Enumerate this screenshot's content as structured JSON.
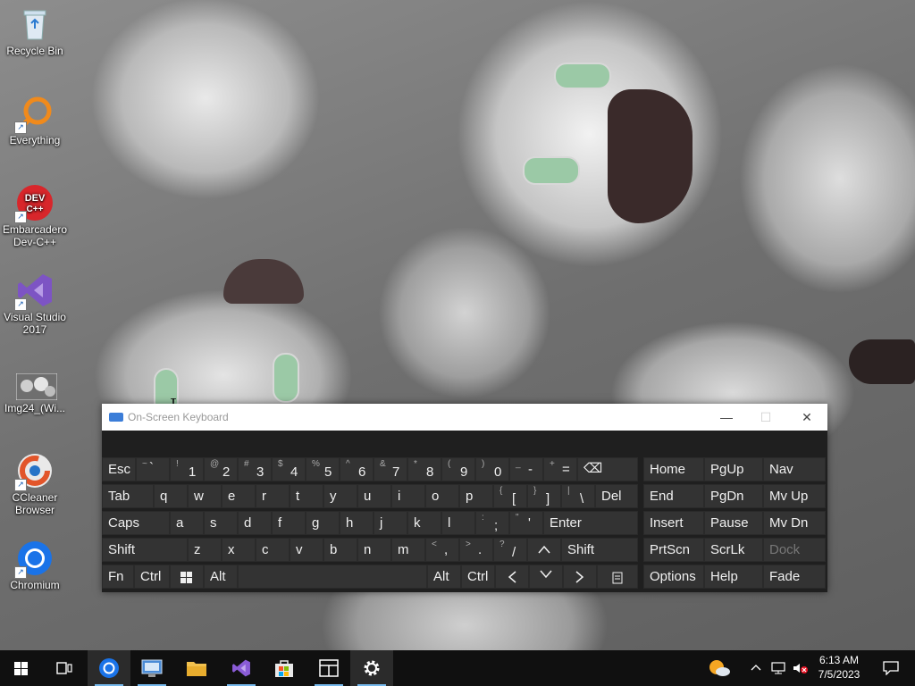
{
  "desktop": {
    "icons": [
      {
        "label": "Recycle Bin"
      },
      {
        "label": "Everything"
      },
      {
        "label": "Embarcadero Dev-C++"
      },
      {
        "label": "Visual Studio 2017"
      },
      {
        "label": "Img24_(Wi..."
      },
      {
        "label": "CCleaner Browser"
      },
      {
        "label": "Chromium"
      }
    ]
  },
  "osk": {
    "title": "On-Screen Keyboard",
    "keys": {
      "esc": "Esc",
      "tilde_shift": "~",
      "tilde": "`",
      "n1s": "!",
      "n1": "1",
      "n2s": "@",
      "n2": "2",
      "n3s": "#",
      "n3": "3",
      "n4s": "$",
      "n4": "4",
      "n5s": "%",
      "n5": "5",
      "n6s": "^",
      "n6": "6",
      "n7s": "&",
      "n7": "7",
      "n8s": "*",
      "n8": "8",
      "n9s": "(",
      "n9": "9",
      "n0s": ")",
      "n0": "0",
      "minus_s": "_",
      "minus": "-",
      "eq_s": "+",
      "eq": "=",
      "backspace": "⌫",
      "tab": "Tab",
      "q": "q",
      "w": "w",
      "e": "e",
      "r": "r",
      "t": "t",
      "y": "y",
      "u": "u",
      "i": "i",
      "o": "o",
      "p": "p",
      "lb_s": "{",
      "lb": "[",
      "rb_s": "}",
      "rb": "]",
      "bs_s": "|",
      "bs": "\\",
      "del": "Del",
      "caps": "Caps",
      "a": "a",
      "s": "s",
      "d": "d",
      "f": "f",
      "g": "g",
      "h": "h",
      "j": "j",
      "k": "k",
      "l": "l",
      "semi_s": ":",
      "semi": ";",
      "quote_s": "\"",
      "quote": "'",
      "enter": "Enter",
      "shift": "Shift",
      "z": "z",
      "x": "x",
      "c": "c",
      "v": "v",
      "b": "b",
      "n": "n",
      "m": "m",
      "comma_s": "<",
      "comma": ",",
      "period_s": ">",
      "period": ".",
      "slash_s": "?",
      "slash": "/",
      "up": "^",
      "shift_r": "Shift",
      "fn": "Fn",
      "ctrl": "Ctrl",
      "alt": "Alt",
      "alt_r": "Alt",
      "ctrl_r": "Ctrl",
      "left": "<",
      "down": "v",
      "right": ">",
      "home": "Home",
      "pgup": "PgUp",
      "nav": "Nav",
      "end": "End",
      "pgdn": "PgDn",
      "mvup": "Mv Up",
      "insert": "Insert",
      "pause": "Pause",
      "mvdn": "Mv Dn",
      "prtscn": "PrtScn",
      "scrlk": "ScrLk",
      "dock": "Dock",
      "options": "Options",
      "help": "Help",
      "fade": "Fade"
    }
  },
  "taskbar": {
    "apps": [
      {
        "name": "start"
      },
      {
        "name": "task-view"
      },
      {
        "name": "chromium"
      },
      {
        "name": "remote-desktop"
      },
      {
        "name": "file-explorer"
      },
      {
        "name": "visual-studio"
      },
      {
        "name": "microsoft-store"
      },
      {
        "name": "window-app"
      },
      {
        "name": "settings"
      }
    ],
    "time": "6:13 AM",
    "date": "7/5/2023"
  },
  "colors": {
    "osk_bg": "#1f1f1f",
    "key_bg": "#333333",
    "taskbar_bg": "#101010",
    "accent": "#76b9ed"
  }
}
